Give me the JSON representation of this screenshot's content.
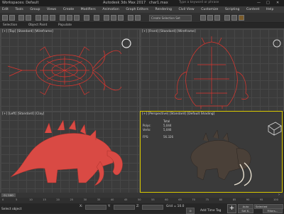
{
  "window": {
    "workspace": "Workspaces: Default",
    "app_title": "Autodesk 3ds Max 2017",
    "file_name": "char1.max",
    "search_placeholder": "Type a keyword or phrase"
  },
  "menu": [
    "Edit",
    "Tools",
    "Group",
    "Views",
    "Create",
    "Modifiers",
    "Animation",
    "Graph Editors",
    "Rendering",
    "Civil View",
    "Customize",
    "Scripting",
    "Content",
    "Help"
  ],
  "selection_set": "Create Selection Set",
  "scene_tabs": [
    "Selection",
    "Object Paint",
    "Populate"
  ],
  "viewports": {
    "top": "[+] [Top] [Standard] [Wireframe]",
    "front": "[+] [Front] [Standard] [Wireframe]",
    "left": "[+] [Left] [Standard] [Clay]",
    "perspective": "[+] [Perspective] [Standard] [Default Shading]"
  },
  "stats": {
    "header": "Total",
    "polys_label": "Polys:",
    "polys_value": "5,044",
    "verts_label": "Verts:",
    "verts_value": "5,046",
    "fps_label": "FPS:",
    "fps_value": "56.326"
  },
  "timeline": {
    "frame_display": "0 / 100",
    "ticks": [
      "0",
      "5",
      "10",
      "15",
      "20",
      "25",
      "30",
      "35",
      "40",
      "45",
      "50",
      "55",
      "60",
      "65",
      "70",
      "75",
      "80",
      "85",
      "90",
      "95",
      "100"
    ]
  },
  "status": {
    "selection": "Select object",
    "x_label": "X:",
    "y_label": "Y:",
    "z_label": "Z:",
    "grid": "Grid = 10.0",
    "add_time_tag": "Add Time Tag",
    "auto_key": "Auto",
    "set_key": "Set K.",
    "selected": "Selected",
    "filters": "Filters..."
  },
  "colors": {
    "model_wire": "#e0352e",
    "model_clay": "#d94a44",
    "active_border": "#d8c800"
  }
}
